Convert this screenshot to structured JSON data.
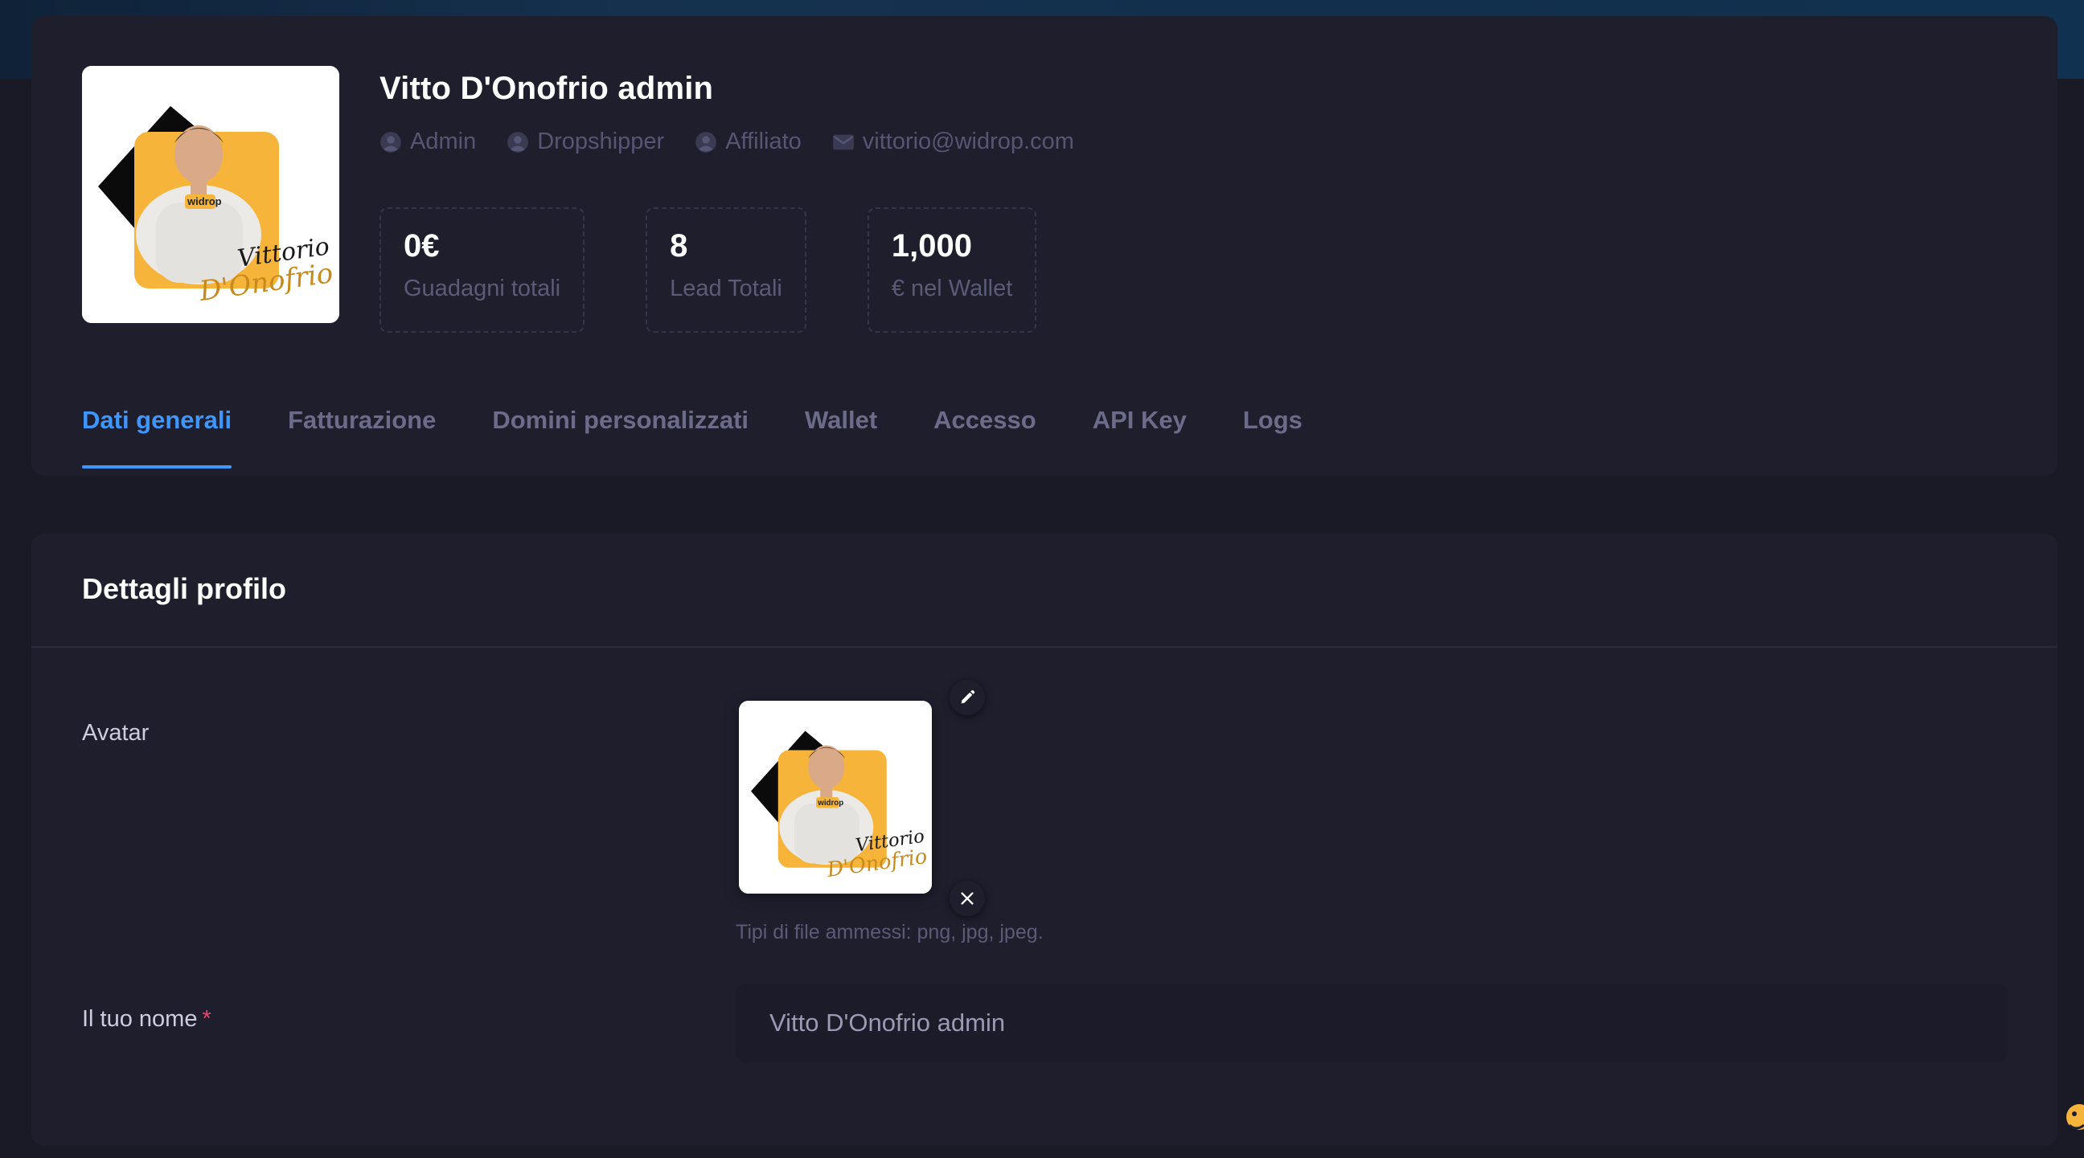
{
  "header": {
    "user_name": "Vitto D'Onofrio admin",
    "roles": [
      {
        "label": "Admin",
        "icon": "user-circle-icon"
      },
      {
        "label": "Dropshipper",
        "icon": "user-circle-icon"
      },
      {
        "label": "Affiliato",
        "icon": "user-circle-icon"
      },
      {
        "label": "vittorio@widrop.com",
        "icon": "envelope-icon"
      }
    ],
    "avatar_signature": [
      "Vittorio",
      "D'Onofrio"
    ],
    "avatar_shirt_logo": "widrop"
  },
  "stats": [
    {
      "value": "0€",
      "label": "Guadagni totali"
    },
    {
      "value": "8",
      "label": "Lead Totali"
    },
    {
      "value": "1,000",
      "label": "€ nel Wallet"
    }
  ],
  "tabs": [
    {
      "label": "Dati generali",
      "active": true
    },
    {
      "label": "Fatturazione",
      "active": false
    },
    {
      "label": "Domini personalizzati",
      "active": false
    },
    {
      "label": "Wallet",
      "active": false
    },
    {
      "label": "Accesso",
      "active": false
    },
    {
      "label": "API Key",
      "active": false
    },
    {
      "label": "Logs",
      "active": false
    }
  ],
  "details": {
    "title": "Dettagli profilo",
    "avatar_label": "Avatar",
    "avatar_hint": "Tipi di file ammessi: png, jpg, jpeg.",
    "name_label": "Il tuo nome",
    "name_required_mark": "*",
    "name_value": "Vitto D'Onofrio admin"
  },
  "colors": {
    "background": "#1a1a26",
    "card": "#1e1e2d",
    "accent": "#3e97ff",
    "muted_text": "#565674",
    "required": "#f1416c",
    "avatar_yellow": "#f6b43a"
  }
}
